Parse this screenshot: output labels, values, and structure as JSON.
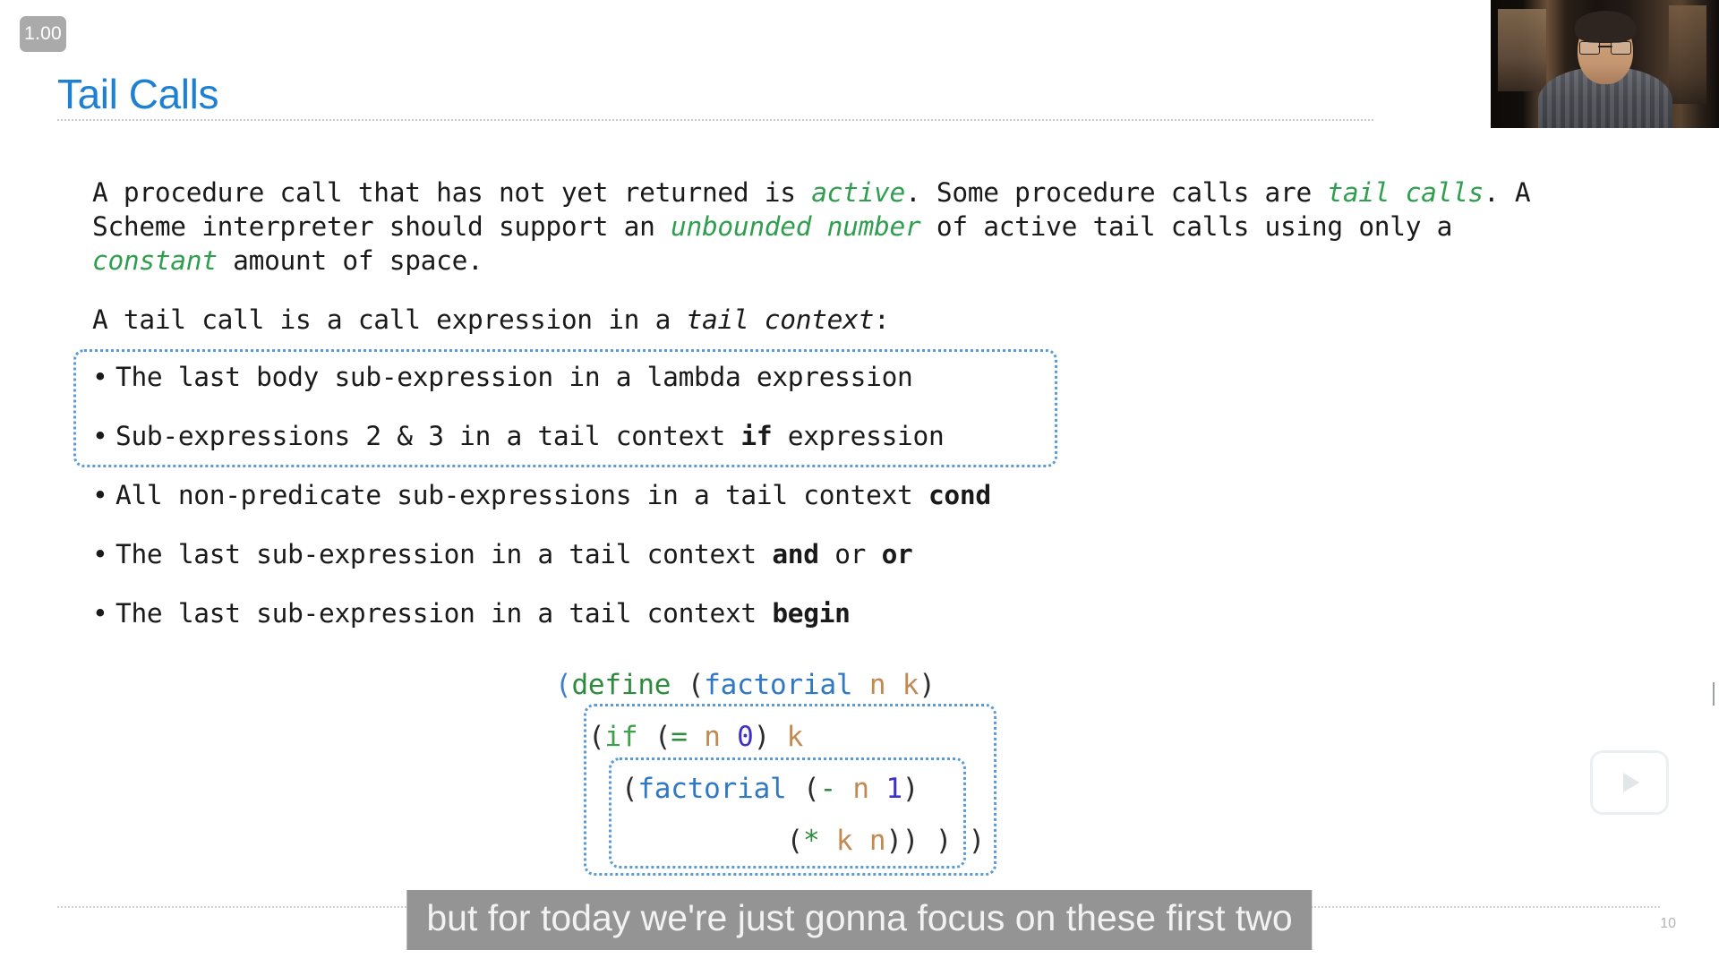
{
  "player": {
    "speed_badge": "1.00",
    "play_icon": "play-triangle-icon",
    "webcam_label": "instructor-webcam"
  },
  "slide": {
    "title": "Tail Calls",
    "page_number": "10",
    "paragraphs": [
      {
        "id": "para1",
        "runs": [
          {
            "text": "A procedure call that has not yet returned is ",
            "style": "plain"
          },
          {
            "text": "active",
            "style": "em-green"
          },
          {
            "text": ". Some procedure calls are ",
            "style": "plain"
          },
          {
            "text": "tail calls",
            "style": "em-green"
          },
          {
            "text": ". A Scheme interpreter should support an ",
            "style": "plain"
          },
          {
            "text": "unbounded number",
            "style": "em-green"
          },
          {
            "text": " of active tail calls using only a ",
            "style": "plain"
          },
          {
            "text": "constant",
            "style": "em-green"
          },
          {
            "text": " amount of space.",
            "style": "plain"
          }
        ]
      },
      {
        "id": "para2",
        "runs": [
          {
            "text": "A tail call is a call expression in a ",
            "style": "plain"
          },
          {
            "text": "tail context",
            "style": "em-ital"
          },
          {
            "text": ":",
            "style": "plain"
          }
        ]
      }
    ],
    "bullets": [
      {
        "marker": "•",
        "runs": [
          {
            "text": "The last body sub-expression in a lambda expression",
            "style": "plain"
          }
        ]
      },
      {
        "marker": "•",
        "runs": [
          {
            "text": "Sub-expressions 2 & 3 in a tail context ",
            "style": "plain"
          },
          {
            "text": "if",
            "style": "kw-bold"
          },
          {
            "text": " expression",
            "style": "plain"
          }
        ]
      },
      {
        "marker": "•",
        "runs": [
          {
            "text": "All non-predicate sub-expressions in a tail context ",
            "style": "plain"
          },
          {
            "text": "cond",
            "style": "kw-bold"
          }
        ]
      },
      {
        "marker": "•",
        "runs": [
          {
            "text": "The last sub-expression in a tail context ",
            "style": "plain"
          },
          {
            "text": "and",
            "style": "kw-bold"
          },
          {
            "text": " or ",
            "style": "plain"
          },
          {
            "text": "or",
            "style": "kw-bold"
          }
        ]
      },
      {
        "marker": "•",
        "runs": [
          {
            "text": "The last sub-expression in a tail context ",
            "style": "plain"
          },
          {
            "text": "begin",
            "style": "kw-bold"
          }
        ]
      }
    ],
    "code_lines": [
      {
        "runs": [
          {
            "text": "(",
            "style": "c-paren"
          },
          {
            "text": "define",
            "style": "c-define"
          },
          {
            "text": " ",
            "style": "plain"
          },
          {
            "text": "(",
            "style": "c-paren-dark"
          },
          {
            "text": "factorial",
            "style": "c-fn"
          },
          {
            "text": " ",
            "style": "plain"
          },
          {
            "text": "n",
            "style": "c-var"
          },
          {
            "text": " ",
            "style": "plain"
          },
          {
            "text": "k",
            "style": "c-var"
          },
          {
            "text": ")",
            "style": "c-paren-dark"
          }
        ]
      },
      {
        "runs": [
          {
            "text": "  ",
            "style": "plain"
          },
          {
            "text": "(",
            "style": "c-paren-dark"
          },
          {
            "text": "if",
            "style": "c-kw"
          },
          {
            "text": " ",
            "style": "plain"
          },
          {
            "text": "(",
            "style": "c-paren-dark"
          },
          {
            "text": "=",
            "style": "c-op"
          },
          {
            "text": " ",
            "style": "plain"
          },
          {
            "text": "n",
            "style": "c-var"
          },
          {
            "text": " ",
            "style": "plain"
          },
          {
            "text": "0",
            "style": "c-num"
          },
          {
            "text": ")",
            "style": "c-paren-dark"
          },
          {
            "text": " ",
            "style": "plain"
          },
          {
            "text": "k",
            "style": "c-var"
          }
        ]
      },
      {
        "runs": [
          {
            "text": "    ",
            "style": "plain"
          },
          {
            "text": "(",
            "style": "c-paren-dark"
          },
          {
            "text": "factorial",
            "style": "c-fn"
          },
          {
            "text": " ",
            "style": "plain"
          },
          {
            "text": "(",
            "style": "c-paren-dark"
          },
          {
            "text": "-",
            "style": "c-op"
          },
          {
            "text": " ",
            "style": "plain"
          },
          {
            "text": "n",
            "style": "c-var"
          },
          {
            "text": " ",
            "style": "plain"
          },
          {
            "text": "1",
            "style": "c-num"
          },
          {
            "text": ")",
            "style": "c-paren-dark"
          }
        ]
      },
      {
        "runs": [
          {
            "text": "              ",
            "style": "plain"
          },
          {
            "text": "(",
            "style": "c-paren-dark"
          },
          {
            "text": "*",
            "style": "c-op"
          },
          {
            "text": " ",
            "style": "plain"
          },
          {
            "text": "k",
            "style": "c-var"
          },
          {
            "text": " ",
            "style": "plain"
          },
          {
            "text": "n",
            "style": "c-var"
          },
          {
            "text": "))",
            "style": "c-paren-dark"
          },
          {
            "text": " ",
            "style": "plain"
          },
          {
            "text": ")",
            "style": "c-paren-dark"
          },
          {
            "text": " ",
            "style": "plain"
          },
          {
            "text": ")",
            "style": "c-paren-dark"
          }
        ]
      }
    ],
    "annotation_boxes": [
      {
        "name": "tail-context-bullets-box",
        "color": "#5b9bd5"
      },
      {
        "name": "if-expression-box",
        "color": "#5b9bd5"
      },
      {
        "name": "recursive-call-box",
        "color": "#5b9bd5"
      }
    ]
  },
  "caption": {
    "text": "but for today we're just gonna focus on these first two"
  },
  "colors": {
    "title": "#1e80d2",
    "emphasis_green": "#2f9e4f",
    "annotation_blue": "#5b9bd5",
    "caption_bg": "#949494",
    "badge_bg": "#aaaaaa"
  }
}
